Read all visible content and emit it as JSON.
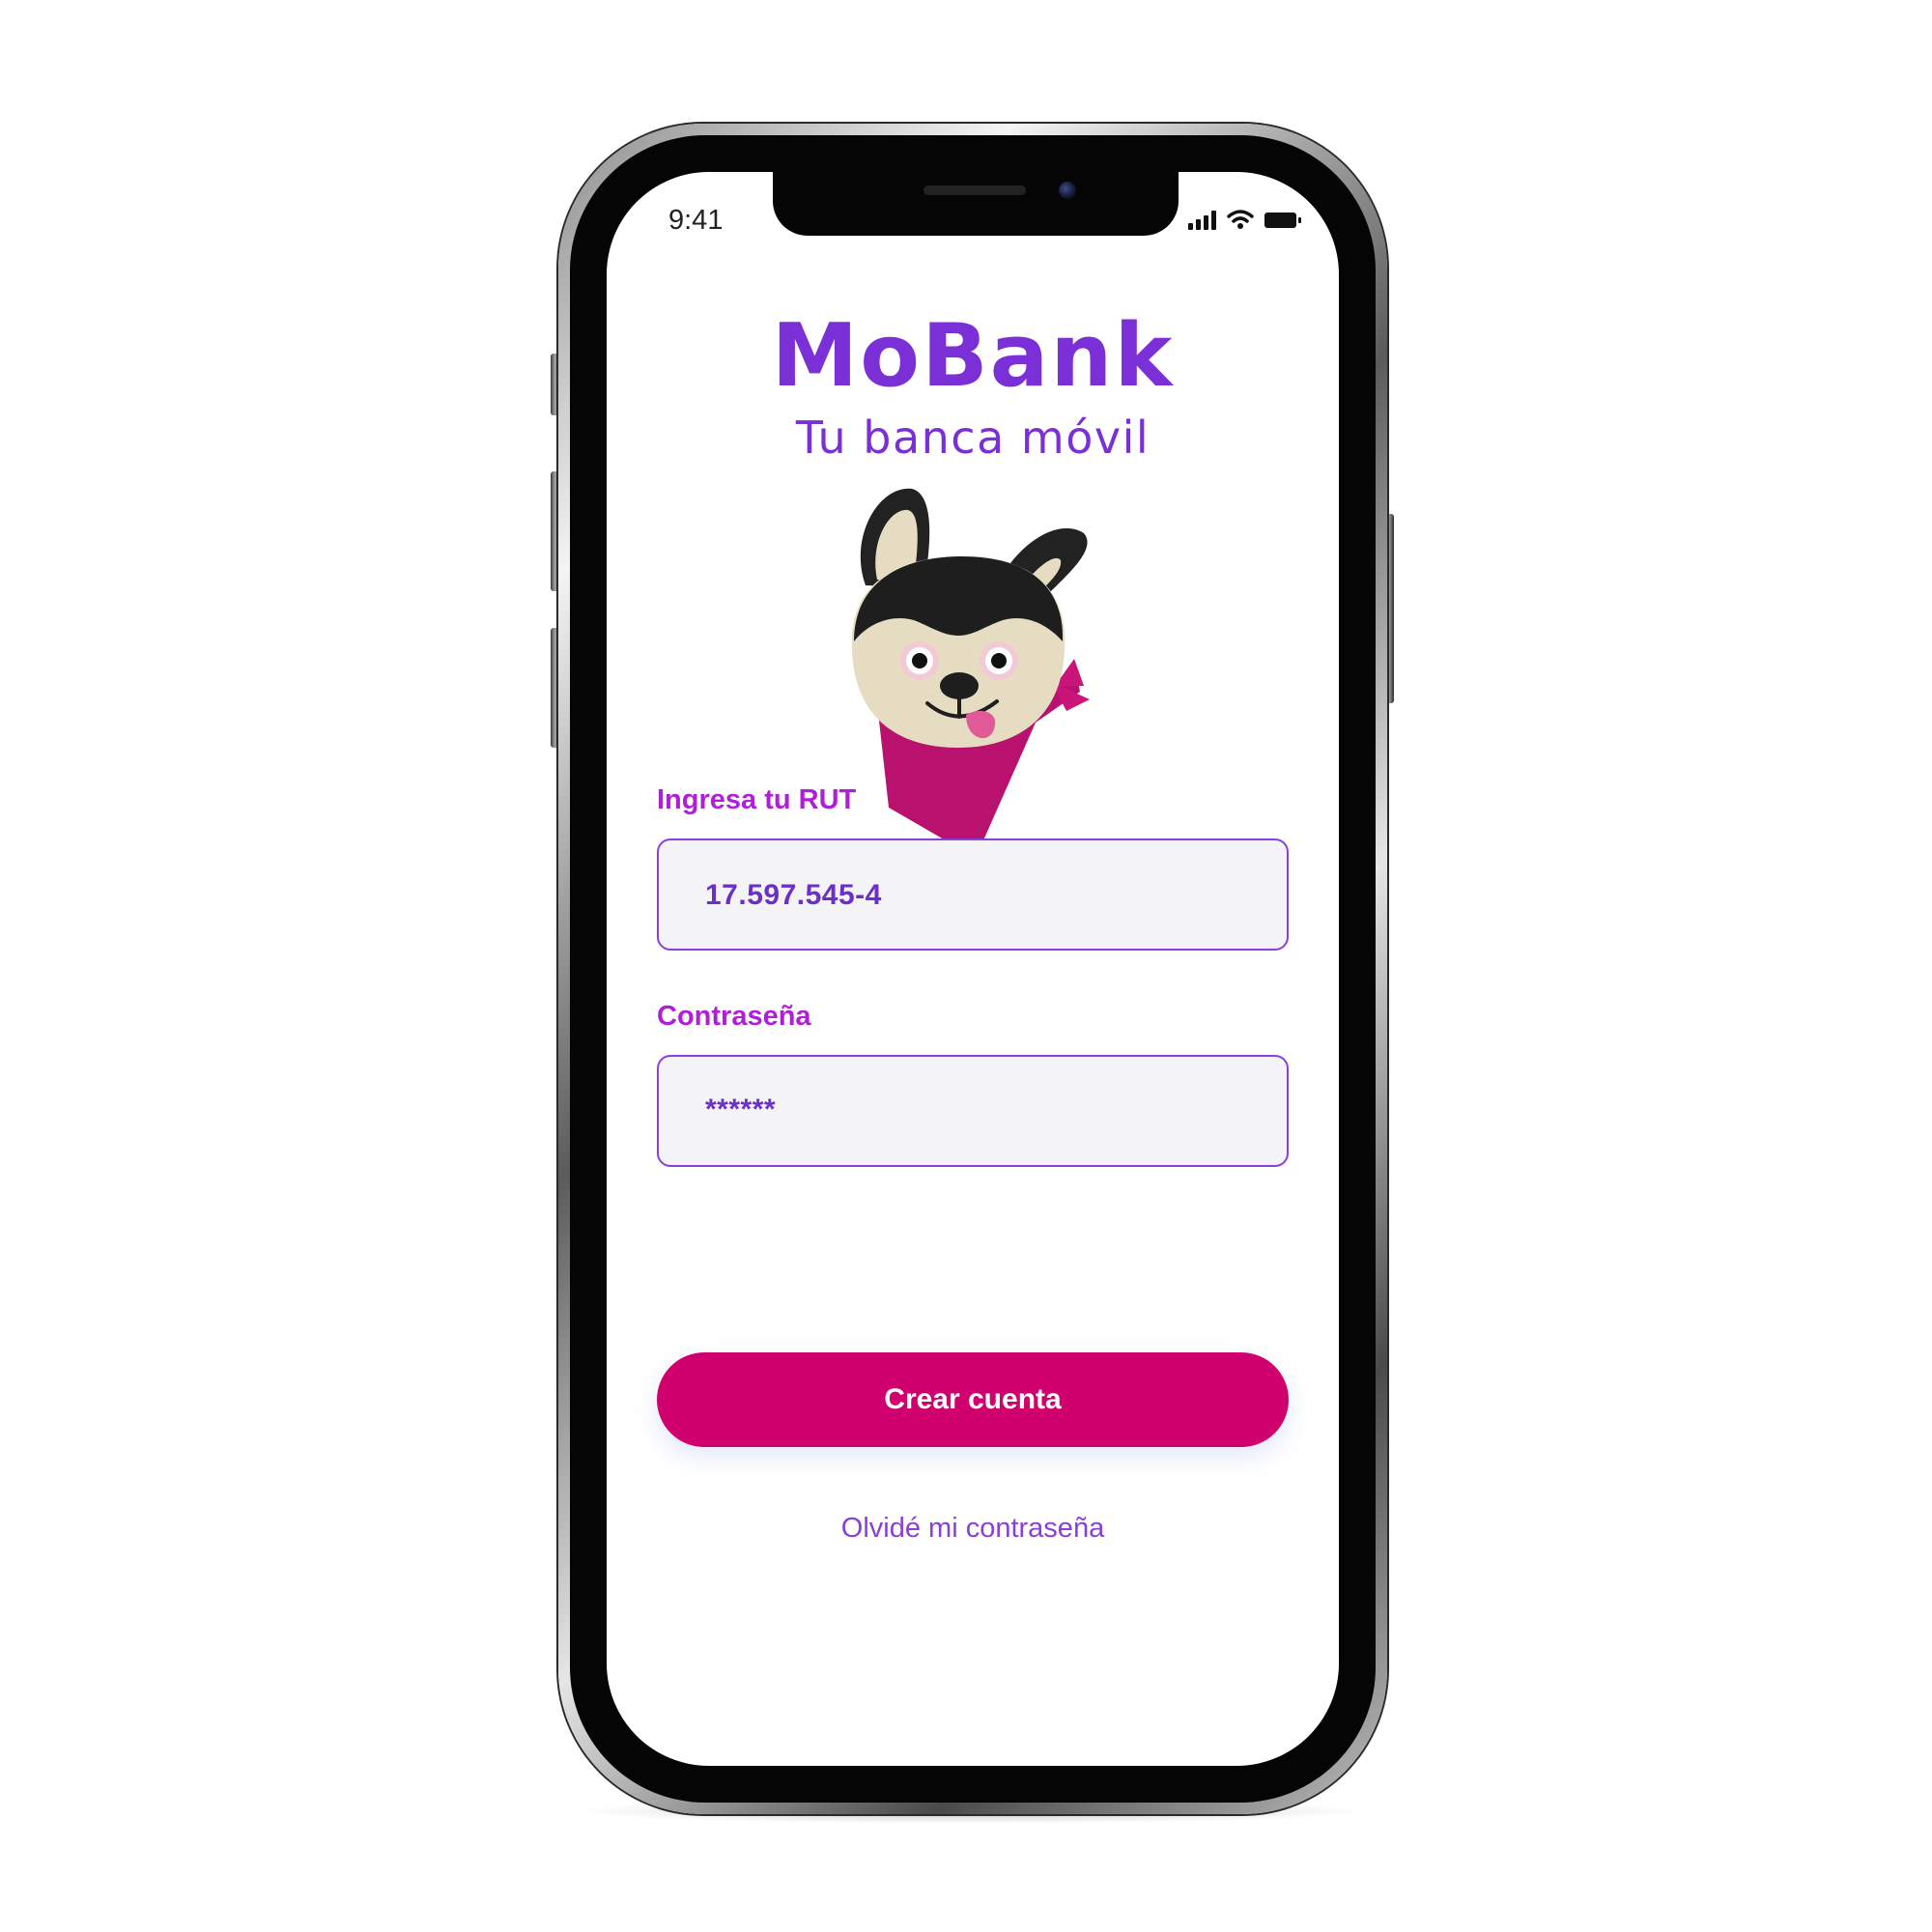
{
  "status_bar": {
    "time": "9:41"
  },
  "app": {
    "title": "MoBank",
    "subtitle": "Tu banca móvil"
  },
  "login_form": {
    "rut_label": "Ingresa tu RUT",
    "rut_value": "17.597.545-4",
    "password_label": "Contraseña",
    "password_value": "******",
    "submit_label": "Crear cuenta",
    "forgot_link": "Olvidé mi contraseña"
  },
  "icons": [
    "signal-icon",
    "wifi-icon",
    "battery-icon",
    "mascot-dog-icon"
  ],
  "colors": {
    "brand_purple": "#7b2fd6",
    "label_magenta": "#b01fd8",
    "button_magenta": "#d1006f",
    "bandana": "#b8126e"
  }
}
